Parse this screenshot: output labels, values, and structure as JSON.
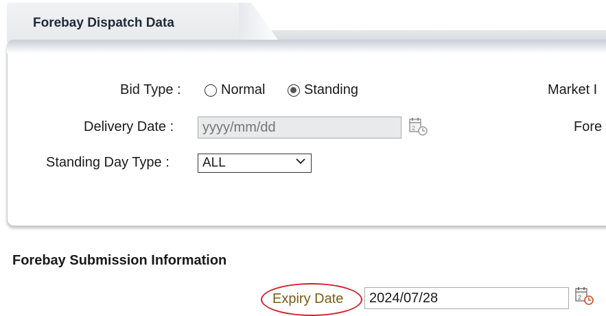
{
  "tab": {
    "title": "Forebay Dispatch Data"
  },
  "form": {
    "bid_type_label": "Bid Type :",
    "bid_type_options": [
      {
        "label": "Normal",
        "selected": false
      },
      {
        "label": "Standing",
        "selected": true
      }
    ],
    "delivery_date_label": "Delivery Date :",
    "delivery_date_placeholder": "yyyy/mm/dd",
    "standing_day_type_label": "Standing Day Type :",
    "standing_day_type_value": "ALL",
    "market_label_partial": "Market I",
    "fore_label_partial": "Fore"
  },
  "submission": {
    "title": "Forebay Submission Information",
    "expiry_date_label": "Expiry Date",
    "expiry_date_value": "2024/07/28"
  },
  "colors": {
    "highlight": "#d0202a",
    "tab_bg": "#e7e9ec"
  },
  "icons": [
    "calendar-icon",
    "chevron-down-icon"
  ]
}
